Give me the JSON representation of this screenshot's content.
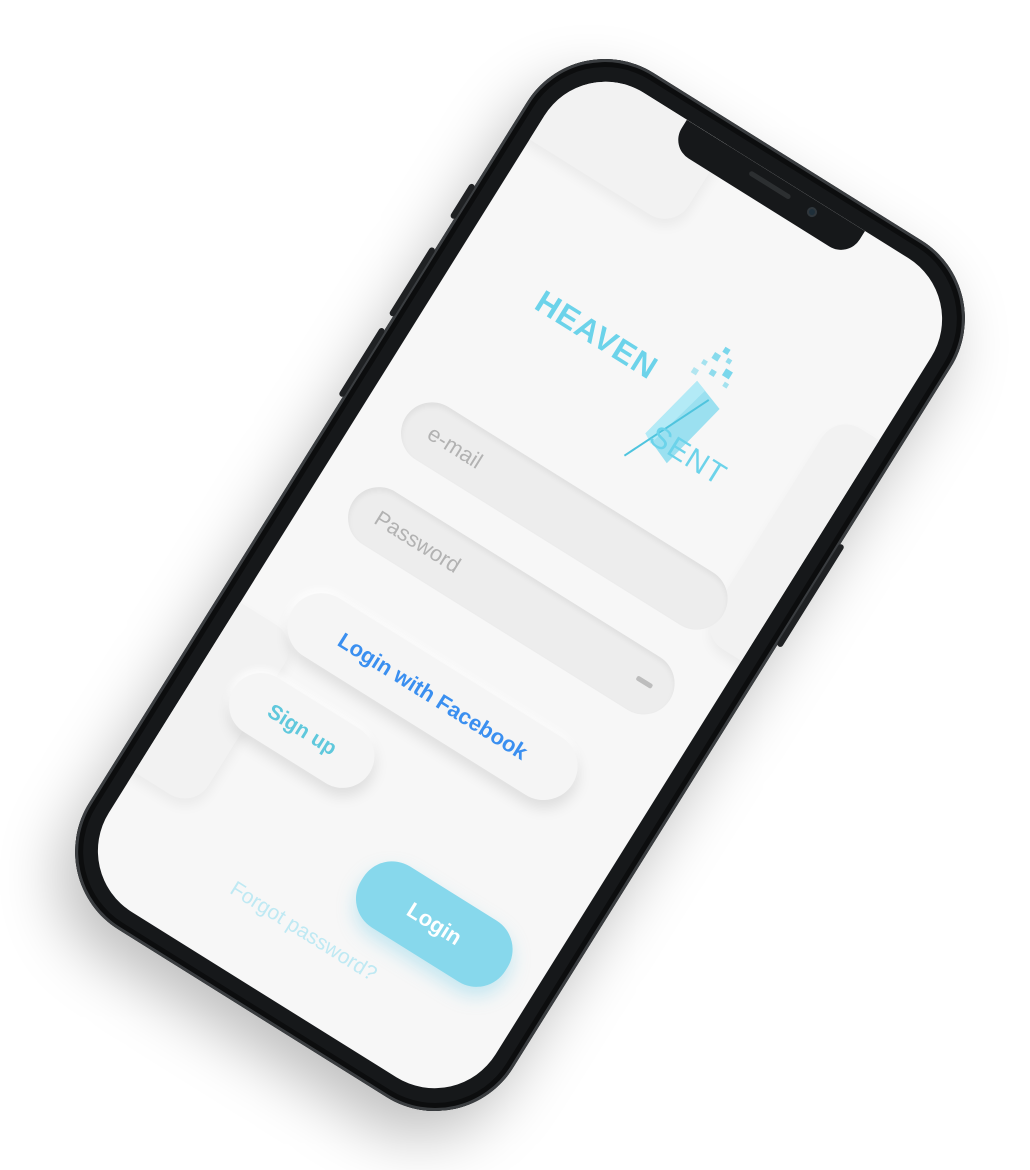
{
  "colors": {
    "accent": "#6cd3ea",
    "login_button": "#87d8ec",
    "facebook_text": "#3a8ff0",
    "signup_text": "#5fc8dc",
    "forgot_text": "#bfe9f3",
    "screen_background": "#f7f7f7",
    "phone_frame": "#16181a"
  },
  "logo": {
    "word_top": "HEAVEN",
    "word_bottom": "SENT",
    "icon": "feather-icon"
  },
  "form": {
    "email_placeholder": "e-mail",
    "password_placeholder": "Password"
  },
  "buttons": {
    "facebook_label": "Login with Facebook",
    "signup_label": "Sign up",
    "login_label": "Login"
  },
  "links": {
    "forgot_label": "Forgot password?"
  }
}
